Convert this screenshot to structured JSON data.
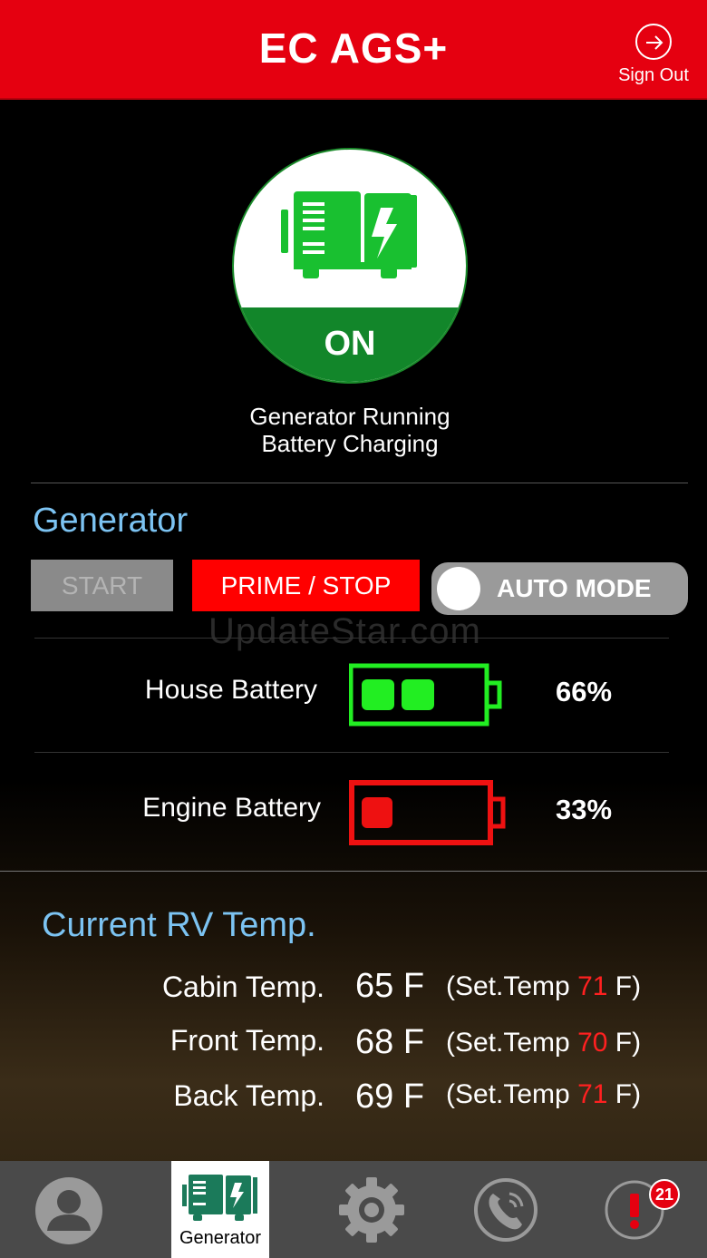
{
  "header": {
    "title": "EC AGS+",
    "sign_out_label": "Sign Out"
  },
  "generator_status": {
    "state": "ON",
    "line1": "Generator Running",
    "line2": "Battery Charging"
  },
  "generator_section": {
    "title": "Generator",
    "start_label": "START",
    "prime_stop_label": "PRIME / STOP",
    "auto_mode_label": "AUTO MODE"
  },
  "watermark": "UpdateStar.com",
  "batteries": [
    {
      "label": "House Battery",
      "percent_text": "66%",
      "level": 0.66,
      "color": "#22ee22"
    },
    {
      "label": "Engine Battery",
      "percent_text": "33%",
      "level": 0.33,
      "color": "#ee1111"
    }
  ],
  "temps": {
    "title": "Current RV Temp.",
    "rows": [
      {
        "label": "Cabin Temp.",
        "value": "65 F",
        "set_prefix": "(Set.Temp ",
        "set_value": "71",
        "set_suffix": " F)"
      },
      {
        "label": "Front Temp.",
        "value": "68 F",
        "set_prefix": "(Set.Temp ",
        "set_value": "70",
        "set_suffix": " F)"
      },
      {
        "label": "Back Temp.",
        "value": "69 F",
        "set_prefix": "(Set.Temp ",
        "set_value": "71",
        "set_suffix": " F)"
      }
    ]
  },
  "tabbar": {
    "active_tab_label": "Generator",
    "alert_count": "21",
    "icons": [
      "user-icon",
      "generator-icon",
      "gear-icon",
      "phone-icon",
      "alert-icon"
    ]
  },
  "colors": {
    "header_red": "#e50010",
    "on_green": "#12862a",
    "accent_blue": "#7cc3f2",
    "set_temp_red": "#ff2020"
  }
}
